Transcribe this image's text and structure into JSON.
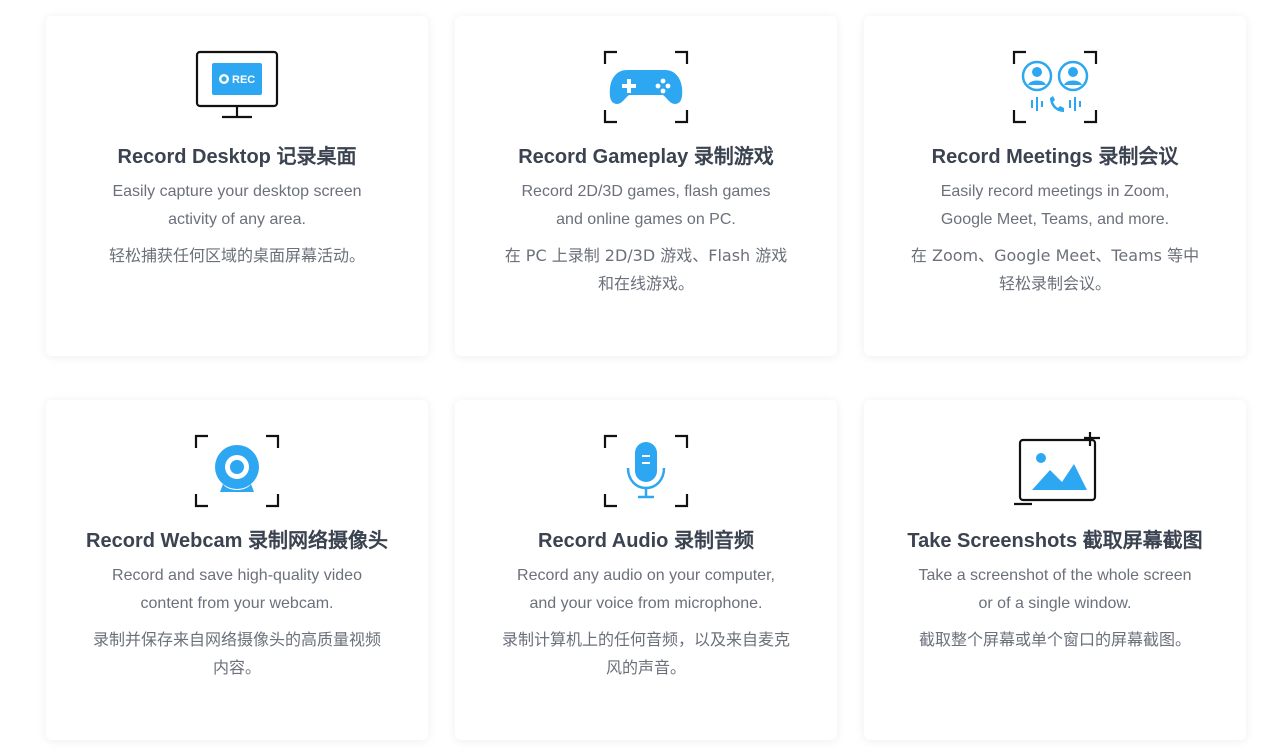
{
  "colors": {
    "accent": "#2ea7f2",
    "title": "#3b4250",
    "body": "#6b707a",
    "icon_stroke": "#111111"
  },
  "cards": [
    {
      "icon": "monitor-rec-icon",
      "icon_text": "REC",
      "title": "Record Desktop 记录桌面",
      "desc_en": "Easily capture your desktop screen activity of any area.",
      "desc_zh": "轻松捕获任何区域的桌面屏幕活动。"
    },
    {
      "icon": "gamepad-icon",
      "title": "Record Gameplay 录制游戏",
      "desc_en": "Record 2D/3D games, flash games and online games on PC.",
      "desc_zh": "在 PC 上录制 2D/3D 游戏、Flash 游戏和在线游戏。"
    },
    {
      "icon": "meeting-people-icon",
      "title": "Record Meetings 录制会议",
      "desc_en": "Easily record meetings in Zoom, Google Meet, Teams, and more.",
      "desc_zh": "在 Zoom、Google Meet、Teams 等中轻松录制会议。"
    },
    {
      "icon": "webcam-icon",
      "title": "Record Webcam 录制网络摄像头",
      "desc_en": "Record and save high-quality video content from your webcam.",
      "desc_zh": "录制并保存来自网络摄像头的高质量视频内容。"
    },
    {
      "icon": "microphone-icon",
      "title": "Record Audio 录制音频",
      "desc_en": "Record any audio on your computer, and your voice from microphone.",
      "desc_zh": "录制计算机上的任何音频，以及来自麦克风的声音。"
    },
    {
      "icon": "screenshot-image-icon",
      "title": "Take Screenshots 截取屏幕截图",
      "desc_en": "Take a screenshot of the whole screen or of a single window.",
      "desc_zh": "截取整个屏幕或单个窗口的屏幕截图。"
    }
  ]
}
